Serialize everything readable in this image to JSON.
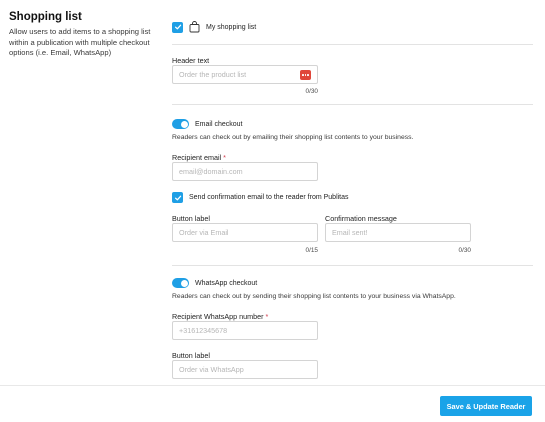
{
  "section": {
    "title": "Shopping list",
    "description": "Allow users to add items to a shopping list within a publication with multiple checkout options (i.e. Email, WhatsApp)"
  },
  "my_shopping_list": {
    "label": "My shopping list",
    "checked": true
  },
  "header_text": {
    "label": "Header text",
    "placeholder": "Order the product list",
    "counter": "0/30"
  },
  "email_checkout": {
    "toggle_label": "Email checkout",
    "enabled": true,
    "description": "Readers can check out by emailing their shopping list contents to your business.",
    "recipient_label": "Recipient email",
    "required_mark": "*",
    "recipient_placeholder": "email@domain.com",
    "confirm_label": "Send confirmation email to the reader from Publitas",
    "confirm_checked": true,
    "button_label": "Button label",
    "button_placeholder": "Order via Email",
    "button_counter": "0/15",
    "confirmation_label": "Confirmation message",
    "confirmation_placeholder": "Email sent!",
    "confirmation_counter": "0/30"
  },
  "whatsapp_checkout": {
    "toggle_label": "WhatsApp checkout",
    "enabled": true,
    "description": "Readers can check out by sending their shopping list contents to your business via WhatsApp.",
    "number_label": "Recipient WhatsApp number",
    "required_mark": "*",
    "number_placeholder": "+31612345678",
    "button_label": "Button label",
    "button_placeholder": "Order via WhatsApp"
  },
  "footer": {
    "save_label": "Save & Update Reader"
  },
  "colors": {
    "accent": "#1aa3e8",
    "required": "#d0394a",
    "emoji": "#e0473b"
  }
}
